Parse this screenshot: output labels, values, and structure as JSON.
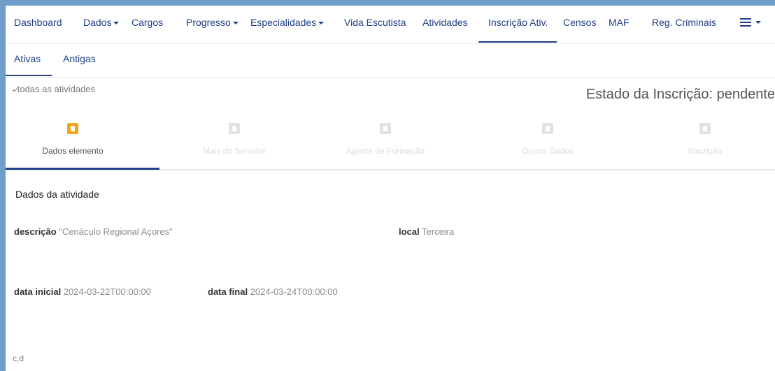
{
  "nav": {
    "items": [
      {
        "label": "Dashboard"
      },
      {
        "label": "Dados",
        "dropdown": true
      },
      {
        "label": "Cargos"
      },
      {
        "label": "Progresso",
        "dropdown": true
      },
      {
        "label": "Especialidades",
        "dropdown": true
      },
      {
        "label": "Vida Escutista"
      },
      {
        "label": "Atividades"
      },
      {
        "label": "Inscrição Ativ.",
        "active": true
      },
      {
        "label": "Censos"
      },
      {
        "label": "MAF"
      },
      {
        "label": "Reg. Criminais"
      }
    ],
    "menu_icon": "hamburger-icon"
  },
  "subnav": {
    "items": [
      {
        "label": "Ativas",
        "active": true
      },
      {
        "label": "Antigas"
      }
    ]
  },
  "back": {
    "label": "todas as atividades",
    "icon": "reply-arrow-icon"
  },
  "estado": "Estado da Inscrição: pendente",
  "steps": [
    {
      "label": "Dados elemento",
      "active": true,
      "icon": "user-icon"
    },
    {
      "label": "Mais do Servidor",
      "active": false,
      "icon": "user-icon"
    },
    {
      "label": "Agente de Formação",
      "active": false,
      "icon": "bookmark-icon"
    },
    {
      "label": "Outros Dados",
      "active": false,
      "icon": "bookmark-icon"
    },
    {
      "label": "Inscrição",
      "active": false,
      "icon": "heart-icon"
    }
  ],
  "section": {
    "title": "Dados da atividade",
    "descricao_label": "descrição",
    "descricao_value": "\"Cenáculo Regional Açores\"",
    "local_label": "local",
    "local_value": "Terceira",
    "data_inicial_label": "data inicial",
    "data_inicial_value": "2024-03-22T00:00:00",
    "data_final_label": "data final",
    "data_final_value": "2024-03-24T00:00:00"
  },
  "footer_text": "c,d",
  "colors": {
    "nav_text": "#1f3f86",
    "step_active": "#f3a51a",
    "outer_bg": "#6f9ec9"
  }
}
